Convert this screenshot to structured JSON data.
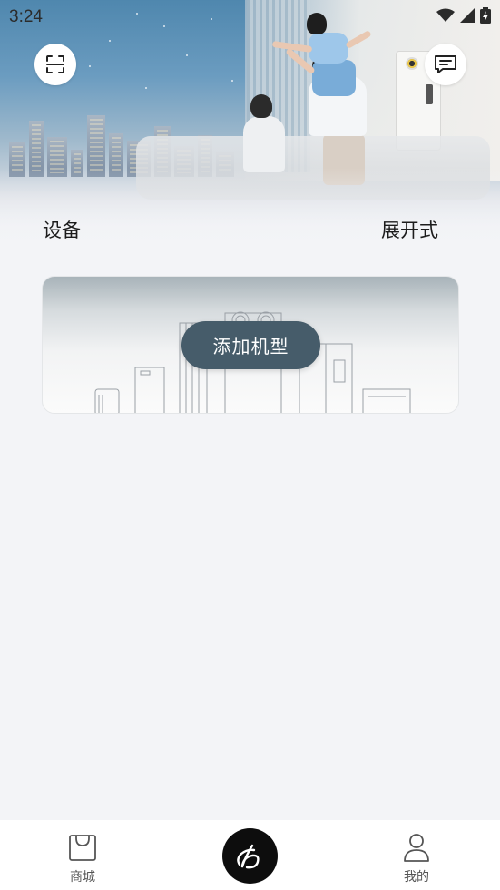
{
  "status_bar": {
    "time": "3:24"
  },
  "header": {
    "scan_icon": "scan-icon",
    "message_icon": "message-icon"
  },
  "devices": {
    "title": "设备",
    "view_mode_label": "展开式",
    "add_model_label": "添加机型"
  },
  "tabbar": {
    "items": [
      {
        "label": "商城",
        "icon": "shopping-bag-icon"
      },
      {
        "label": "",
        "icon": "brand-logo-icon"
      },
      {
        "label": "我的",
        "icon": "user-icon"
      }
    ]
  },
  "colors": {
    "accent_button": "#465c6a",
    "background": "#f3f4f7",
    "center_button": "#0d0d0d"
  }
}
